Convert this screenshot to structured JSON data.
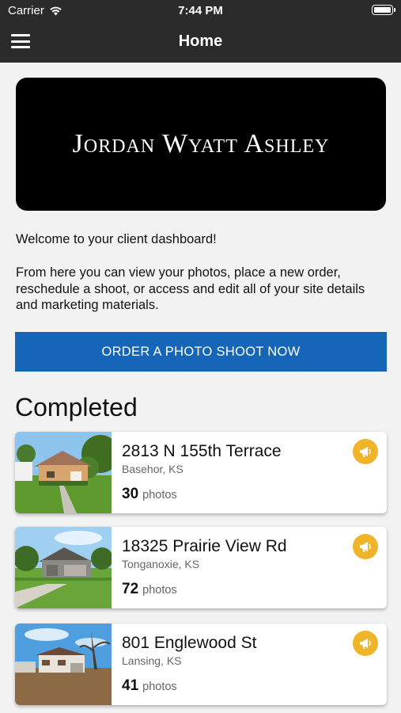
{
  "status_bar": {
    "carrier": "Carrier",
    "time": "7:44 PM"
  },
  "nav": {
    "title": "Home",
    "menu_icon": "hamburger-menu-icon"
  },
  "logo": {
    "text": "Jordan Wyatt Ashley"
  },
  "welcome": "Welcome to your client dashboard!",
  "intro": "From here you can view your photos, place a new order, reschedule a shoot, or access and edit all of your site details and marketing materials.",
  "cta_label": "ORDER A PHOTO SHOOT NOW",
  "section_title": "Completed",
  "photos_label": "photos",
  "listings": [
    {
      "address": "2813 N 155th Terrace",
      "city": "Basehor, KS",
      "count": "30"
    },
    {
      "address": "18325 Prairie View Rd",
      "city": "Tonganoxie, KS",
      "count": "72"
    },
    {
      "address": "801 Englewood St",
      "city": "Lansing, KS",
      "count": "41"
    }
  ],
  "colors": {
    "nav_bg": "#2b2b2b",
    "cta_bg": "#1565b8",
    "promo_badge": "#f0b429",
    "background": "#f2f2f2"
  }
}
